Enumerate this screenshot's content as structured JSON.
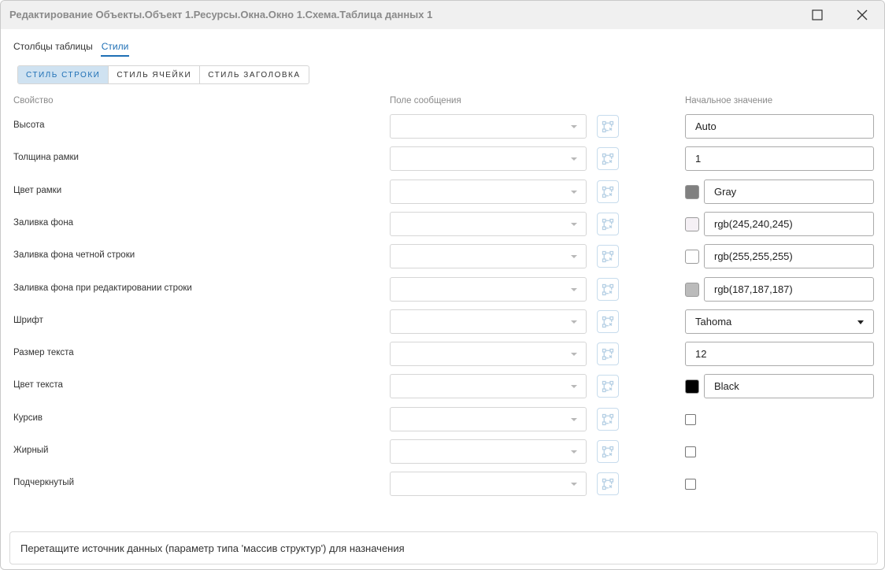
{
  "window": {
    "title": "Редактирование Объекты.Объект 1.Ресурсы.Окна.Окно 1.Схема.Таблица данных 1",
    "maximize_icon": "maximize-icon",
    "close_icon": "close-icon"
  },
  "tabs": [
    {
      "label": "Столбцы таблицы",
      "active": false
    },
    {
      "label": "Стили",
      "active": true
    }
  ],
  "style_tabs": [
    {
      "label": "СТИЛЬ СТРОКИ",
      "active": true
    },
    {
      "label": "СТИЛЬ ЯЧЕЙКИ",
      "active": false
    },
    {
      "label": "СТИЛЬ ЗАГОЛОВКА",
      "active": false
    }
  ],
  "columns": {
    "property": "Свойство",
    "message_field": "Поле сообщения",
    "initial_value": "Начальное значение"
  },
  "rows": [
    {
      "label": "Высота",
      "kind": "text",
      "value": "Auto"
    },
    {
      "label": "Толщина рамки",
      "kind": "text",
      "value": "1"
    },
    {
      "label": "Цвет рамки",
      "kind": "color",
      "value": "Gray",
      "swatch": "#808080"
    },
    {
      "label": "Заливка фона",
      "kind": "color",
      "value": "rgb(245,240,245)",
      "swatch": "#f5f0f5"
    },
    {
      "label": "Заливка фона четной строки",
      "kind": "color",
      "value": "rgb(255,255,255)",
      "swatch": "#ffffff"
    },
    {
      "label": "Заливка фона при редактировании строки",
      "kind": "color",
      "value": "rgb(187,187,187)",
      "swatch": "#bbbbbb"
    },
    {
      "label": "Шрифт",
      "kind": "dropdown",
      "value": "Tahoma"
    },
    {
      "label": "Размер текста",
      "kind": "text",
      "value": "12"
    },
    {
      "label": "Цвет текста",
      "kind": "color",
      "value": "Black",
      "swatch": "#000000"
    },
    {
      "label": "Курсив",
      "kind": "checkbox",
      "checked": false
    },
    {
      "label": "Жирный",
      "kind": "checkbox",
      "checked": false
    },
    {
      "label": "Подчеркнутый",
      "kind": "checkbox",
      "checked": false
    }
  ],
  "message_field": {
    "value": "",
    "caret_icon": "chevron-down-icon",
    "bind_icon": "binding-icon"
  },
  "footer": {
    "hint": "Перетащите источник данных (параметр типа 'массив структур') для назначения"
  },
  "colors": {
    "accent": "#1e6fb5",
    "active_segment_bg": "#cfe2f1",
    "titlebar_bg": "#f0f0f0"
  }
}
